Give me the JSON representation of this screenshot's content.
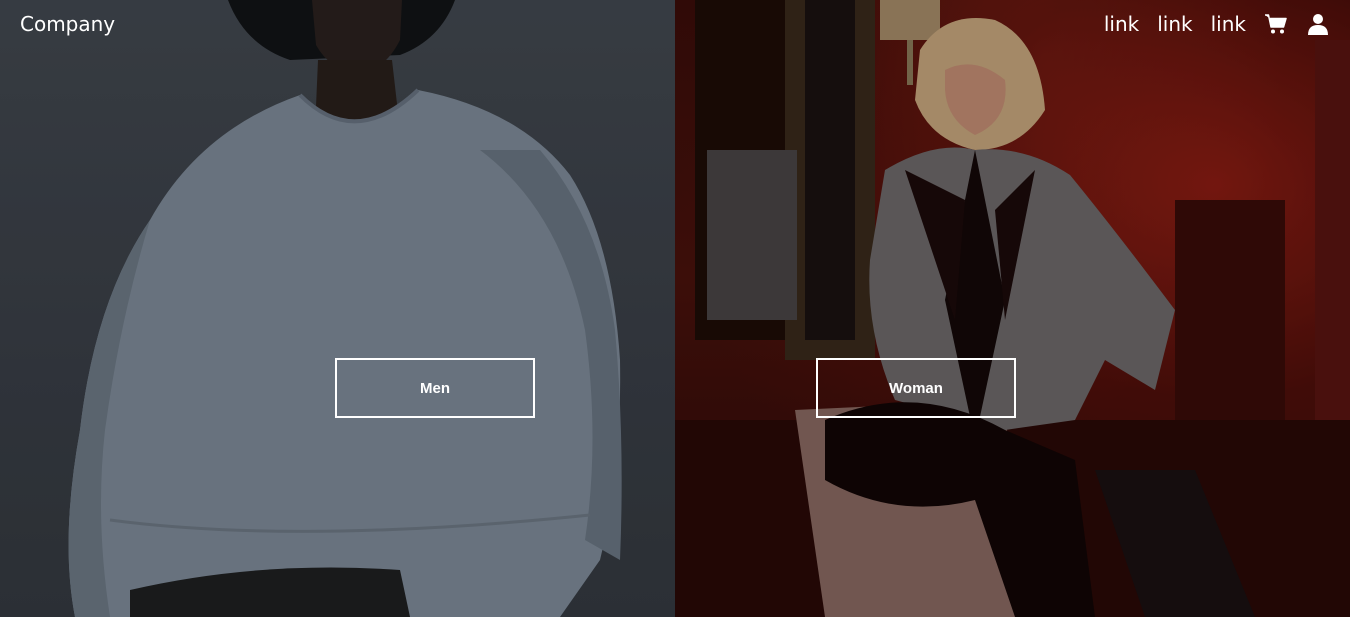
{
  "nav": {
    "brand": "Company",
    "links": [
      {
        "label": "link"
      },
      {
        "label": "link"
      },
      {
        "label": "link"
      }
    ],
    "icons": [
      "cart-icon",
      "user-icon"
    ]
  },
  "hero": {
    "men_button": "Men",
    "women_button": "Woman"
  },
  "colors": {
    "text": "#ffffff",
    "men_bg": "#3a3f47",
    "women_bg": "#4a120c"
  }
}
